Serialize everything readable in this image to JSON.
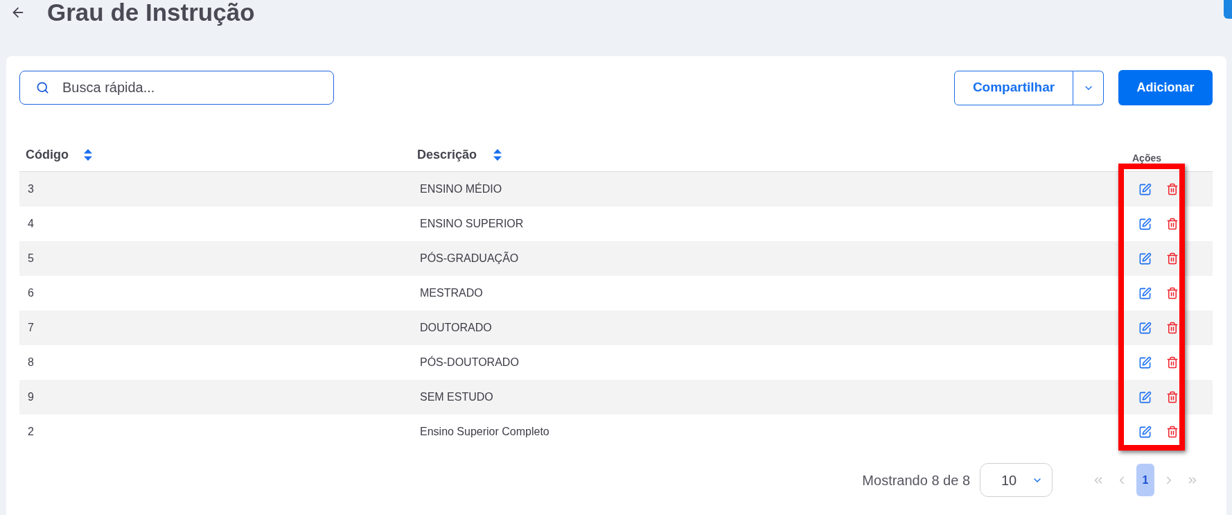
{
  "header": {
    "title": "Grau de Instrução"
  },
  "toolbar": {
    "search": {
      "placeholder": "Busca rápida..."
    },
    "buttons": [
      {
        "kind": "split",
        "label": "Compartilhar"
      },
      {
        "kind": "primary",
        "label": "Adicionar"
      }
    ]
  },
  "table": {
    "columns": [
      {
        "label": "Código",
        "sortable": true
      },
      {
        "label": "Descrição",
        "sortable": true
      },
      {
        "label": "Ações",
        "sortable": false
      }
    ],
    "rows": [
      {
        "cells": [
          "3",
          "ENSINO MÉDIO"
        ]
      },
      {
        "cells": [
          "4",
          "ENSINO SUPERIOR"
        ]
      },
      {
        "cells": [
          "5",
          "PÓS-GRADUAÇÃO"
        ]
      },
      {
        "cells": [
          "6",
          "MESTRADO"
        ]
      },
      {
        "cells": [
          "7",
          "DOUTORADO"
        ]
      },
      {
        "cells": [
          "8",
          "PÓS-DOUTORADO"
        ]
      },
      {
        "cells": [
          "9",
          "SEM ESTUDO"
        ]
      },
      {
        "cells": [
          "2",
          "Ensino Superior Completo"
        ]
      }
    ],
    "actions_highlighted": true
  },
  "pagination": {
    "summary": "Mostrando 8 de 8",
    "page_size": "10",
    "nav": [
      {
        "kind": "first",
        "disabled": true
      },
      {
        "kind": "prev",
        "disabled": true
      },
      {
        "kind": "next",
        "disabled": true
      },
      {
        "kind": "last",
        "disabled": true
      }
    ],
    "pages": [
      {
        "label": "1",
        "selected": true
      }
    ]
  }
}
